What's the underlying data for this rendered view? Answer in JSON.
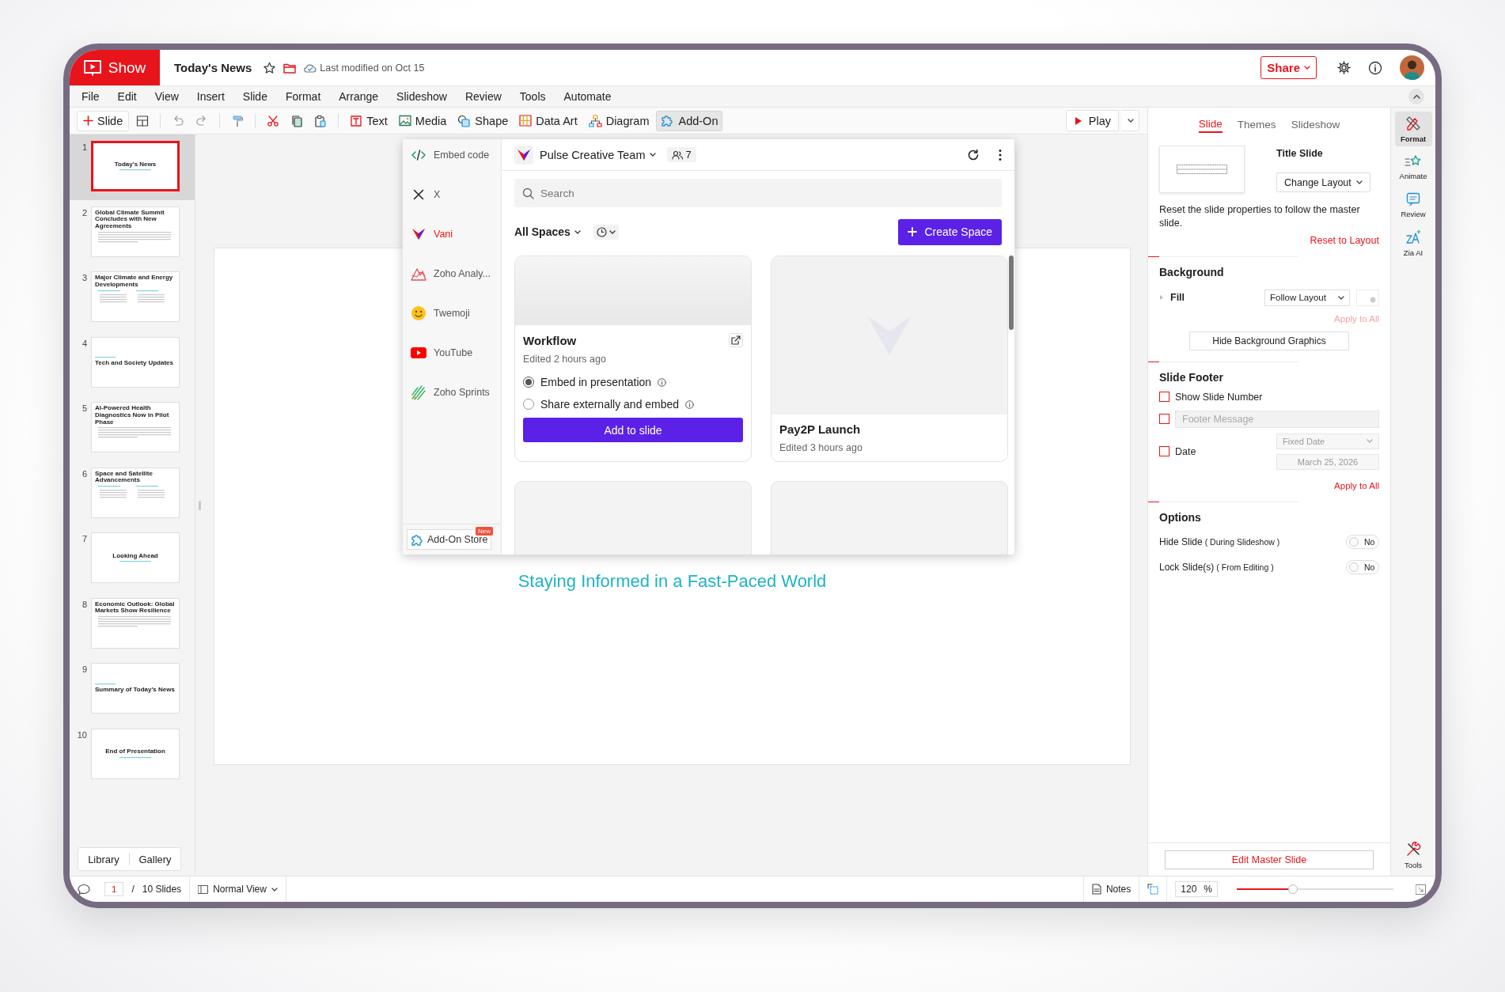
{
  "app": {
    "name": "Show"
  },
  "document": {
    "title": "Today's News",
    "last_modified": "Last modified on Oct 15"
  },
  "header": {
    "share": "Share"
  },
  "menu": [
    "File",
    "Edit",
    "View",
    "Insert",
    "Slide",
    "Format",
    "Arrange",
    "Slideshow",
    "Review",
    "Tools",
    "Automate"
  ],
  "toolbar": {
    "new_slide": "Slide",
    "play": "Play",
    "tools": [
      {
        "kind": "text",
        "label": "Text",
        "selected": false
      },
      {
        "kind": "media",
        "label": "Media",
        "selected": false
      },
      {
        "kind": "shape",
        "label": "Shape",
        "selected": false
      },
      {
        "kind": "data-art",
        "label": "Data Art",
        "selected": false
      },
      {
        "kind": "diagram",
        "label": "Diagram",
        "selected": false
      },
      {
        "kind": "add-on",
        "label": "Add-On",
        "selected": true
      }
    ]
  },
  "slides": [
    {
      "number": "1",
      "title": "Today's News",
      "kind": "title",
      "selected": true
    },
    {
      "number": "2",
      "title": "Global Climate Summit Concludes with New Agreements",
      "kind": "bullets",
      "selected": false
    },
    {
      "number": "3",
      "title": "Major Climate and Energy Developments",
      "kind": "columns",
      "selected": false
    },
    {
      "number": "4",
      "title": "Tech and Society Updates",
      "kind": "section",
      "selected": false
    },
    {
      "number": "5",
      "title": "AI-Powered Health Diagnostics Now in Pilot Phase",
      "kind": "bullets",
      "selected": false
    },
    {
      "number": "6",
      "title": "Space and Satellite Advancements",
      "kind": "columns",
      "selected": false
    },
    {
      "number": "7",
      "title": "Looking Ahead",
      "kind": "title",
      "selected": false
    },
    {
      "number": "8",
      "title": "Economic Outlook: Global Markets Show Resilience",
      "kind": "bullets",
      "selected": false
    },
    {
      "number": "9",
      "title": "Summary of Today's News",
      "kind": "section",
      "selected": false
    },
    {
      "number": "10",
      "title": "End of Presentation",
      "kind": "title",
      "selected": false
    }
  ],
  "panel_buttons": [
    "Library",
    "Gallery"
  ],
  "slide_canvas": {
    "subtitle": "Staying Informed in a Fast-Paced World"
  },
  "addon_popup": {
    "sidebar": [
      {
        "kind": "embed",
        "label": "Embed code",
        "selected": false
      },
      {
        "kind": "x",
        "label": "X",
        "selected": false
      },
      {
        "kind": "vani",
        "label": "Vani",
        "selected": true
      },
      {
        "kind": "analytics",
        "label": "Zoho Analy...",
        "selected": false
      },
      {
        "kind": "emoji",
        "label": "Twemoji",
        "selected": false
      },
      {
        "kind": "video",
        "label": "YouTube",
        "selected": false
      },
      {
        "kind": "sprints",
        "label": "Zoho Sprints",
        "selected": false
      }
    ],
    "store": "Add-On Store",
    "store_badge": "New",
    "team": "Pulse Creative Team",
    "members": "7",
    "search": {
      "placeholder": "Search"
    },
    "filter": "All Spaces",
    "create": "Create Space",
    "cards": [
      {
        "kind": "space",
        "title": "Workflow",
        "edited": "Edited 2 hours ago",
        "expanded": true,
        "options": [
          {
            "label": "Embed in presentation",
            "selected": true
          },
          {
            "label": "Share externally and embed",
            "selected": false
          }
        ],
        "action": "Add to slide"
      },
      {
        "kind": "space",
        "title": "Pay2P Launch",
        "edited": "Edited 3 hours ago",
        "expanded": false
      },
      {
        "kind": "placeholder"
      },
      {
        "kind": "placeholder"
      }
    ]
  },
  "right_panel": {
    "tabs": [
      {
        "label": "Slide",
        "selected": true
      },
      {
        "label": "Themes",
        "selected": false
      },
      {
        "label": "Slideshow",
        "selected": false
      }
    ],
    "layout_name": "Title Slide",
    "change_layout": "Change Layout",
    "reset_note": "Reset the slide properties to follow the master slide.",
    "reset_link": "Reset to Layout",
    "background": {
      "heading": "Background",
      "fill_label": "Fill",
      "fill_value": "Follow Layout",
      "apply_all": "Apply to All",
      "apply_disabled": true,
      "hide_graphics": "Hide Background Graphics"
    },
    "footer": {
      "heading": "Slide Footer",
      "show_number": {
        "label": "Show Slide Number",
        "checked": false
      },
      "message": {
        "checked": false,
        "placeholder": "Footer Message"
      },
      "date": {
        "label": "Date",
        "checked": false,
        "disabled": true,
        "format": "Fixed Date",
        "value": "March 25, 2026"
      },
      "apply_all": "Apply to All"
    },
    "options": {
      "heading": "Options",
      "items": [
        {
          "label": "Hide Slide",
          "hint": "( During Slideshow )",
          "on": false,
          "state": "No"
        },
        {
          "label": "Lock Slide(s)",
          "hint": "( From Editing )",
          "on": false,
          "state": "No"
        }
      ]
    },
    "edit_master": "Edit Master Slide"
  },
  "rail": [
    {
      "kind": "format",
      "label": "Format",
      "selected": true
    },
    {
      "kind": "animate",
      "label": "Animate",
      "selected": false
    },
    {
      "kind": "review",
      "label": "Review",
      "selected": false
    },
    {
      "kind": "ai",
      "label": "Zia AI",
      "selected": false
    }
  ],
  "rail_tools": "Tools",
  "status_bar": {
    "page": "1",
    "separator": "/",
    "total": "10 Slides",
    "view": "Normal View",
    "notes": "Notes",
    "zoom": "120",
    "zoom_unit": "%",
    "zoom_slider": {
      "level": 0.36
    }
  }
}
